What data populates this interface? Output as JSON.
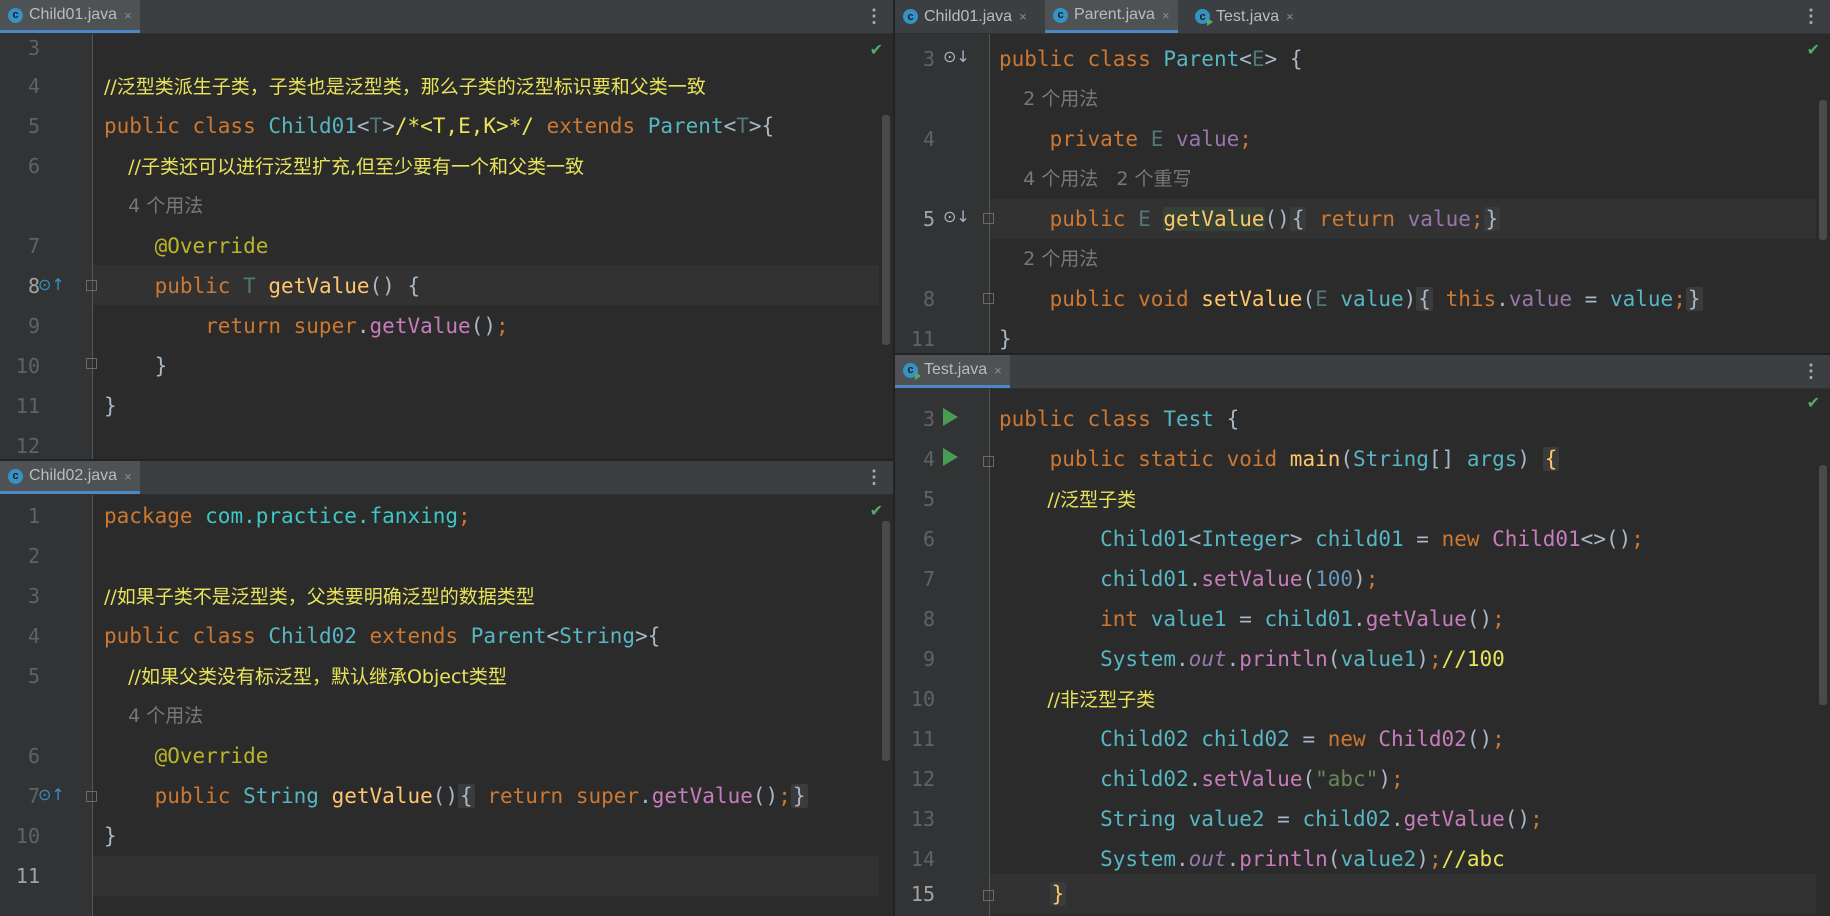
{
  "panes": {
    "child01": {
      "tabs": [
        {
          "label": "Child01.java",
          "active": true
        }
      ],
      "line_numbers": [
        "3",
        "4",
        "5",
        "6",
        "",
        "7",
        "8",
        "9",
        "10",
        "11",
        "12"
      ],
      "lines": [
        "",
        "//泛型类派生子类，子类也是泛型类，那么子类的泛型标识要和父类一致",
        "public class Child01<T>/*<T,E,K>*/ extends Parent<T>{",
        "    //子类还可以进行泛型扩充,但至少要有一个和父类一致",
        "    4 个用法",
        "    @Override",
        "    public T getValue() {",
        "        return super.getValue();",
        "    }",
        "}",
        ""
      ]
    },
    "child02": {
      "tabs": [
        {
          "label": "Child02.java",
          "active": true
        }
      ],
      "line_numbers": [
        "1",
        "2",
        "3",
        "4",
        "5",
        "",
        "6",
        "7",
        "10",
        "11"
      ],
      "lines": [
        "package com.practice.fanxing;",
        "",
        "//如果子类不是泛型类，父类要明确泛型的数据类型",
        "public class Child02 extends Parent<String>{",
        "    //如果父类没有标泛型，默认继承Object类型",
        "    4 个用法",
        "    @Override",
        "    public String getValue() { return super.getValue(); }",
        "}",
        ""
      ]
    },
    "parent": {
      "tabs": [
        {
          "label": "Child01.java",
          "active": false
        },
        {
          "label": "Parent.java",
          "active": true
        },
        {
          "label": "Test.java",
          "active": false
        }
      ],
      "line_numbers": [
        "3",
        "",
        "4",
        "",
        "5",
        "",
        "8",
        "11"
      ],
      "lines": [
        "public class Parent<E> {",
        "    2 个用法",
        "    private E value;",
        "    4 个用法   2 个重写",
        "    public E getValue() { return value; }",
        "    2 个用法",
        "    public void setValue(E value) { this.value = value; }",
        "}"
      ]
    },
    "test": {
      "tabs": [
        {
          "label": "Test.java",
          "active": true
        }
      ],
      "line_numbers": [
        "3",
        "4",
        "5",
        "6",
        "7",
        "8",
        "9",
        "10",
        "11",
        "12",
        "13",
        "14",
        "15"
      ],
      "lines": [
        "public class Test {",
        "    public static void main(String[] args) {",
        "        //泛型子类",
        "        Child01<Integer> child01 = new Child01<>();",
        "        child01.setValue(100);",
        "        int value1 = child01.getValue();",
        "        System.out.println(value1);//100",
        "        //非泛型子类",
        "        Child02 child02 = new Child02();",
        "        child02.setValue(\"abc\");",
        "        String value2 = child02.getValue();",
        "        System.out.println(value2);//abc",
        "    }"
      ]
    }
  },
  "icons": {
    "class_file": "class-c-icon",
    "menu": "kebab-menu-icon",
    "inspection_ok": "checkmark-icon",
    "override": "override-arrow-icon",
    "implemented": "implemented-arrow-icon",
    "run": "run-triangle-icon",
    "close": "close-icon"
  },
  "glyphs": {
    "menu": "⋮",
    "check": "✔",
    "close": "×",
    "class": "c",
    "override": "⊙↑",
    "implemented": "⊙↓"
  },
  "colors": {
    "editor_bg": "#2b2b2b",
    "tabbar_bg": "#3c3f41",
    "keyword": "#cc7832",
    "class_name": "#56b6c2",
    "method": "#ffc66d",
    "annotation": "#bbb529",
    "comment": "#e8e35a",
    "field": "#9876aa",
    "string": "#6a8759",
    "number": "#6897bb",
    "run": "#499c54",
    "check": "#59a869"
  }
}
